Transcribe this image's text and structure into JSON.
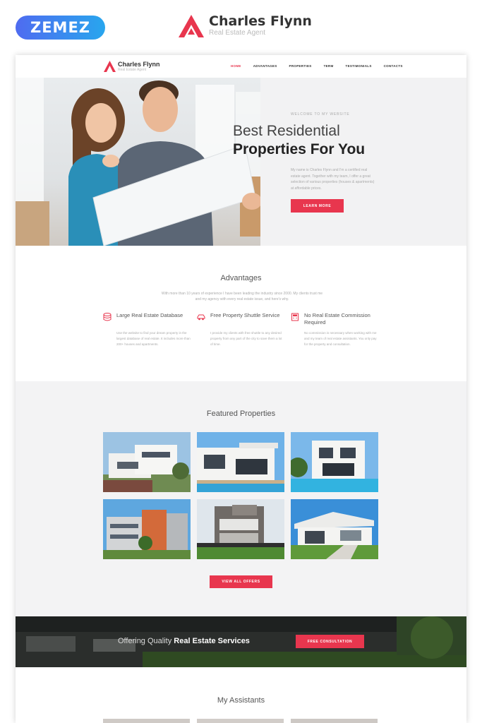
{
  "frame": {
    "badge": "ZEMEZ",
    "brand_name": "Charles Flynn",
    "brand_tagline": "Real Estate Agent",
    "accent": "#e8364e"
  },
  "nav": {
    "logo_name": "Charles Flynn",
    "logo_tagline": "Real Estate Agent",
    "items": [
      "HOME",
      "ADVANTAGES",
      "PROPERTIES",
      "TERM",
      "TESTIMONIALS",
      "CONTACTS"
    ],
    "active": "HOME"
  },
  "hero": {
    "welcome": "WELCOME TO MY WEBSITE",
    "title_line1": "Best Residential",
    "title_line2": "Properties For You",
    "paragraph": "My name is Charles Flynn and I'm a certified real estate agent. Together with my team, I offer a great selection of various properties (houses & apartments) at affordable prices.",
    "cta": "LEARN MORE"
  },
  "advantages": {
    "title": "Advantages",
    "subtitle": "With more than 10 years of experience I have been leading the industry since 2000. My clients trust me and my agency with every real estate issue, and here's why.",
    "items": [
      {
        "icon": "database-icon",
        "title": "Large Real Estate Database",
        "text": "Use the website to find your dream property in the largest database of real estate. It includes more than 200+ houses and apartments."
      },
      {
        "icon": "car-icon",
        "title": "Free Property Shuttle Service",
        "text": "I provide my clients with free shuttle to any desired property from any part of the city to save them a lot of time."
      },
      {
        "icon": "calculator-icon",
        "title": "No Real Estate Commission Required",
        "text": "No commission is necessary when working with me and my team of real estate assistants. You only pay for the property and consultation."
      }
    ]
  },
  "featured": {
    "title": "Featured Properties",
    "cta": "VIEW ALL OFFERS"
  },
  "banner": {
    "text_regular": "Offering Quality",
    "text_bold": "Real Estate Services",
    "cta": "FREE CONSULTATION"
  },
  "assistants": {
    "title": "My Assistants"
  }
}
